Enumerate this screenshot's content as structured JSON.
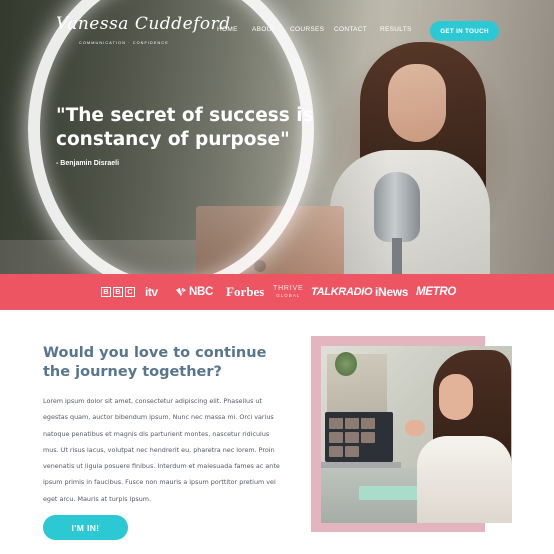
{
  "header": {
    "logo_script": "Vanessa Cuddeford",
    "logo_sub": "COMMUNICATION · CONFIDENCE",
    "nav": [
      "HOME",
      "ABOUT",
      "COURSES",
      "CONTACT",
      "RESULTS"
    ],
    "cta": "GET IN TOUCH"
  },
  "hero": {
    "quote": "\"The secret of success is constancy of purpose\"",
    "author": "- Benjamin Disraeli"
  },
  "press": {
    "bbc": [
      "B",
      "B",
      "C"
    ],
    "itv": "itv",
    "nbc": "NBC",
    "forbes": "Forbes",
    "thrive_top": "THRIVE",
    "thrive_bottom": "GLOBAL",
    "talkradio": "TALKRADIO",
    "inews": "iNews",
    "metro": "METRO"
  },
  "content": {
    "heading": "Would you love to continue the journey together?",
    "body": "Lorem ipsum dolor sit amet, consectetur adipiscing elit. Phasellus ut egestas quam, auctor bibendum ipsum. Nunc nec massa mi. Orci varius natoque penatibus et magnis dis parturient montes, nascetur ridiculus mus. Ut risus lacus, volutpat nec hendrerit eu, pharetra nec lorem. Proin venenatis ut ligula posuere finibus. Interdum et malesuada fames ac ante ipsum primis in faucibus. Fusce non mauris a ipsum porttitor pretium vel eget arcu. Mauris at turpis ipsum.",
    "cta": "I'M IN!"
  },
  "colors": {
    "accent_cyan": "#2cc8d3",
    "press_red": "#ee5563",
    "heading_blue": "#58758f",
    "frame_pink": "#e3b6bf"
  }
}
